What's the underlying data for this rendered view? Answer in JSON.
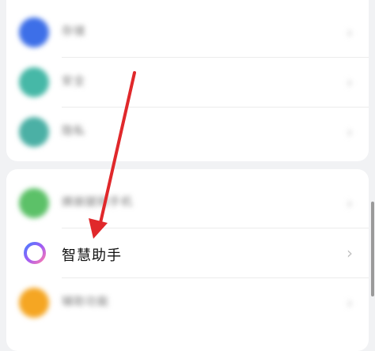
{
  "group_top": {
    "items": [
      {
        "label": "存储",
        "color": "#3d6fe8"
      },
      {
        "label": "安全",
        "color": "#46b8a7"
      },
      {
        "label": "隐私",
        "color": "#4bb0a5"
      }
    ]
  },
  "group_bottom": {
    "items": [
      {
        "label": "姨娘腿刚手机",
        "color": "#5cc168"
      },
      {
        "label": "智慧助手",
        "color": "#7a6ff0",
        "chevron": "›"
      },
      {
        "label": "辅助功能",
        "color": "#f5a623"
      }
    ]
  },
  "colors": {
    "background": "#f1f2f4",
    "arrow": "#e0282b",
    "ring_gradient": [
      "#4a7cff",
      "#9f5cf5",
      "#ff7ab0"
    ]
  },
  "icons": {
    "smart_assistant": "ring-icon",
    "chevron": "chevron-right-icon"
  }
}
